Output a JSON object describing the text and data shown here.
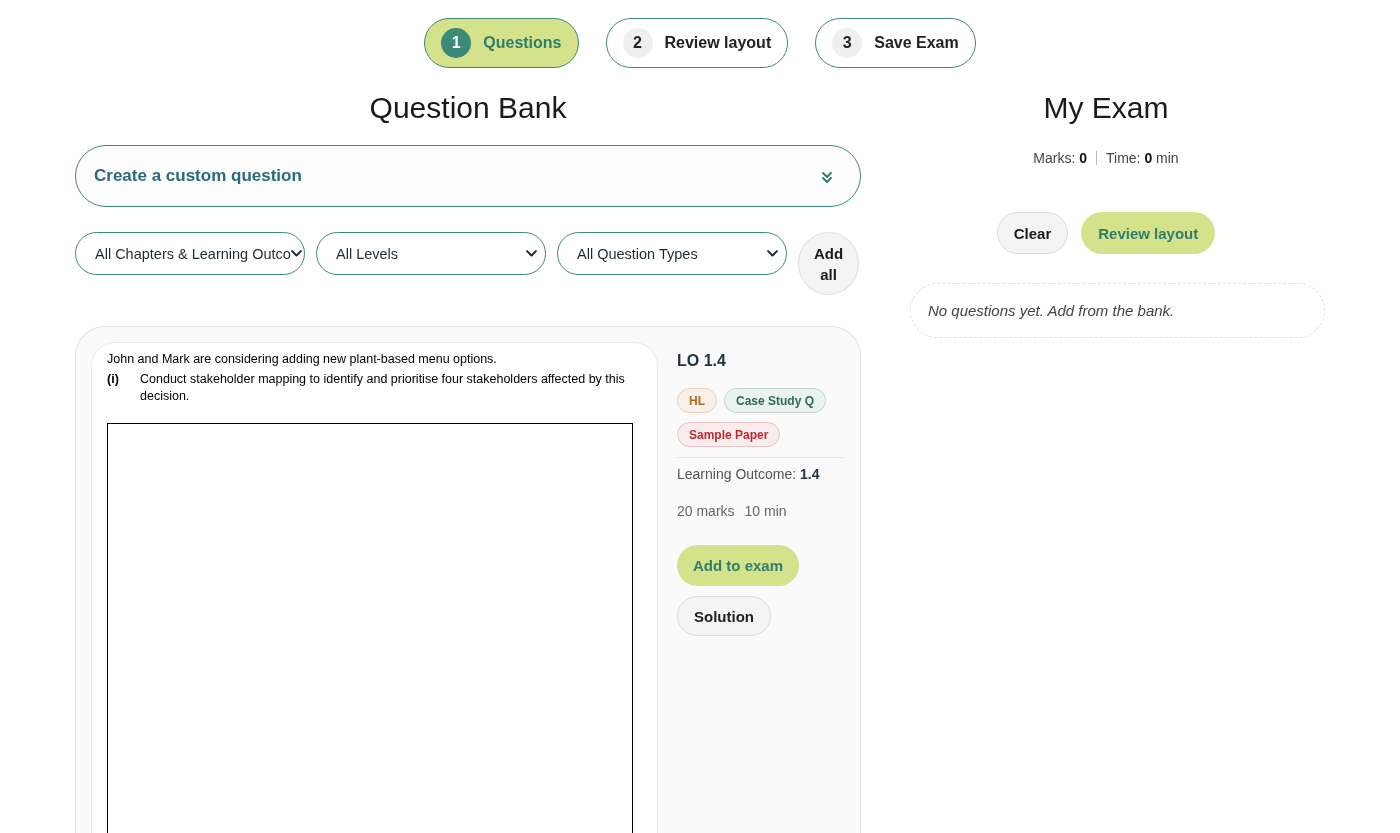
{
  "steps": [
    {
      "number": "1",
      "label": "Questions",
      "selected": true
    },
    {
      "number": "2",
      "label": "Review layout",
      "selected": false
    },
    {
      "number": "3",
      "label": "Save Exam",
      "selected": false
    }
  ],
  "question_bank": {
    "title": "Question Bank",
    "custom_question": {
      "label": "Create a custom question",
      "expanded": false
    },
    "filters": [
      {
        "value": "All Chapters & Learning Outco"
      },
      {
        "value": "All Levels"
      },
      {
        "value": "All Question Types"
      }
    ],
    "add_all_button": "Add all",
    "questions": [
      {
        "document": {
          "intro": "John and Mark are considering adding new plant-based menu options.",
          "parts": [
            {
              "label": "(i)",
              "text": "Conduct stakeholder mapping to identify and prioritise four stakeholders affected by this decision."
            }
          ]
        },
        "lo_title": "LO 1.4",
        "tags": [
          {
            "label": "HL",
            "color": "#b5651d"
          },
          {
            "label": "Case Study Q",
            "color": "#2d6b5a"
          },
          {
            "label": "Sample Paper",
            "color": "#c0282f"
          }
        ],
        "learning_outcome": "Learning Outcome: **1.4**",
        "marks": "20 marks",
        "time": "10 min",
        "add_button": "Add to exam",
        "solution_button": "Solution"
      }
    ]
  },
  "my_exam": {
    "title": "My Exam",
    "summary": [
      "Marks: **0**",
      "Time: **0** min"
    ],
    "buttons": [
      {
        "label": "Clear",
        "kind": "secondary"
      },
      {
        "label": "Review layout",
        "kind": "primary"
      }
    ],
    "empty_message": "No questions yet. Add from the bank."
  }
}
